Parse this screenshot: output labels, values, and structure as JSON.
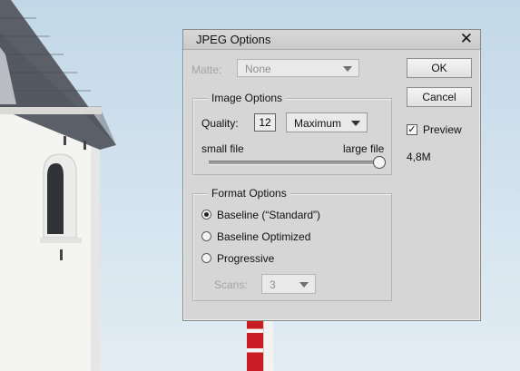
{
  "dialog": {
    "title": "JPEG Options",
    "close_glyph": "✕",
    "matte": {
      "label": "Matte:",
      "value": "None",
      "enabled": false
    },
    "image_options": {
      "title": "Image Options",
      "quality_label": "Quality:",
      "quality_value": "12",
      "quality_preset": "Maximum",
      "small_label": "small file",
      "large_label": "large file",
      "slider_level": 1.0
    },
    "format_options": {
      "title": "Format Options",
      "options": [
        "Baseline (“Standard”)",
        "Baseline Optimized",
        "Progressive"
      ],
      "selected_index": 0,
      "scans_label": "Scans:",
      "scans_value": "3",
      "scans_enabled": false
    },
    "buttons": {
      "ok": "OK",
      "cancel": "Cancel"
    },
    "preview": {
      "label": "Preview",
      "checked": true,
      "check_glyph": "✓"
    },
    "file_size": "4,8M"
  },
  "colors": {
    "dialog_bg": "#d6d6d6",
    "sky": "#cfe0ec",
    "flag_red": "#c81d25"
  }
}
